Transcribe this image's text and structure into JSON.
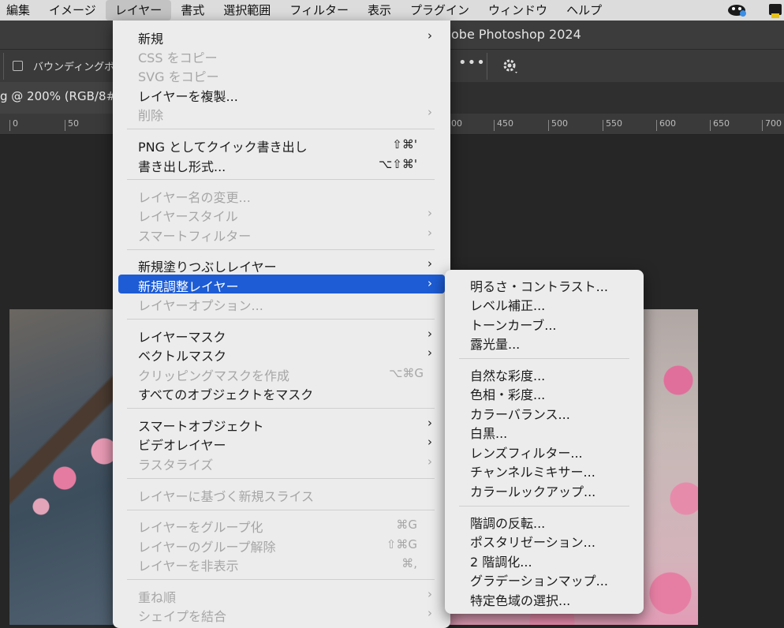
{
  "menubar": {
    "items": [
      "編集",
      "イメージ",
      "レイヤー",
      "書式",
      "選択範囲",
      "フィルター",
      "表示",
      "プラグイン",
      "ウィンドウ",
      "ヘルプ"
    ],
    "active_index": 2
  },
  "window": {
    "title": "obe Photoshop 2024"
  },
  "options": {
    "checkbox_label": "バウンディングボ",
    "more": "•••"
  },
  "document": {
    "tab_title": "g @ 200% (RGB/8#"
  },
  "ruler": {
    "ticks": [
      "0",
      "50",
      "",
      "",
      "",
      "",
      "",
      "",
      "00",
      "450",
      "500",
      "550",
      "600",
      "650",
      "700"
    ]
  },
  "layer_menu": {
    "items": [
      {
        "label": "新規",
        "arrow": "›",
        "enabled": true
      },
      {
        "label": "CSS をコピー",
        "enabled": false
      },
      {
        "label": "SVG をコピー",
        "enabled": false
      },
      {
        "label": "レイヤーを複製...",
        "enabled": true
      },
      {
        "label": "削除",
        "arrow": "›",
        "enabled": false
      },
      {
        "label": "PNG としてクイック書き出し",
        "shortcut": "⇧⌘'",
        "enabled": true
      },
      {
        "label": "書き出し形式...",
        "shortcut": "⌥⇧⌘'",
        "enabled": true
      },
      {
        "label": "レイヤー名の変更...",
        "enabled": false
      },
      {
        "label": "レイヤースタイル",
        "arrow": "›",
        "enabled": false
      },
      {
        "label": "スマートフィルター",
        "arrow": "›",
        "enabled": false
      },
      {
        "label": "新規塗りつぶしレイヤー",
        "arrow": "›",
        "enabled": true
      },
      {
        "label": "新規調整レイヤー",
        "arrow": "›",
        "enabled": true,
        "highlighted": true
      },
      {
        "label": "レイヤーオプション...",
        "enabled": false
      },
      {
        "label": "レイヤーマスク",
        "arrow": "›",
        "enabled": true
      },
      {
        "label": "ベクトルマスク",
        "arrow": "›",
        "enabled": true
      },
      {
        "label": "クリッピングマスクを作成",
        "shortcut": "⌥⌘G",
        "enabled": false
      },
      {
        "label": "すべてのオブジェクトをマスク",
        "enabled": true
      },
      {
        "label": "スマートオブジェクト",
        "arrow": "›",
        "enabled": true
      },
      {
        "label": "ビデオレイヤー",
        "arrow": "›",
        "enabled": true
      },
      {
        "label": "ラスタライズ",
        "arrow": "›",
        "enabled": false
      },
      {
        "label": "レイヤーに基づく新規スライス",
        "enabled": false
      },
      {
        "label": "レイヤーをグループ化",
        "shortcut": "⌘G",
        "enabled": false
      },
      {
        "label": "レイヤーのグループ解除",
        "shortcut": "⇧⌘G",
        "enabled": false
      },
      {
        "label": "レイヤーを非表示",
        "shortcut": "⌘,",
        "enabled": false
      },
      {
        "label": "重ね順",
        "arrow": "›",
        "enabled": false
      },
      {
        "label": "シェイプを結合",
        "arrow": "›",
        "enabled": false
      }
    ]
  },
  "adjustment_submenu": {
    "items": [
      "明るさ・コントラスト...",
      "レベル補正...",
      "トーンカーブ...",
      "露光量...",
      "自然な彩度...",
      "色相・彩度...",
      "カラーバランス...",
      "白黒...",
      "レンズフィルター...",
      "チャンネルミキサー...",
      "カラールックアップ...",
      "階調の反転...",
      "ポスタリゼーション...",
      "2 階調化...",
      "グラデーションマップ...",
      "特定色域の選択..."
    ]
  },
  "colors": {
    "highlight": "#1d5cd4",
    "menu_bg": "#ececec",
    "app_bg": "#262626"
  }
}
